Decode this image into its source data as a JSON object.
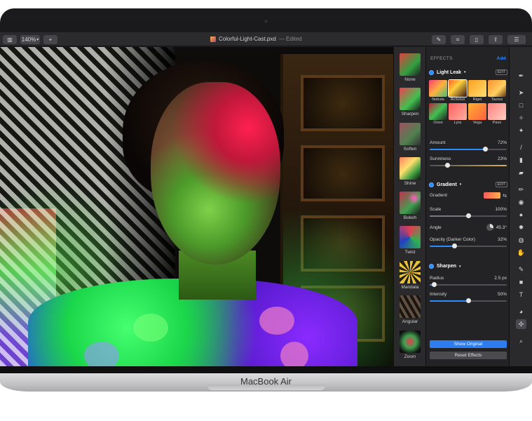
{
  "device": {
    "label": "MacBook Air"
  },
  "toolbar": {
    "zoom": "140%",
    "add": "+",
    "file_name": "Colorful-Light-Cast.pxd",
    "status": "— Edited"
  },
  "presets": [
    {
      "label": "None"
    },
    {
      "label": "Sharpen"
    },
    {
      "label": "Soften"
    },
    {
      "label": "Shine"
    },
    {
      "label": "Bokeh"
    },
    {
      "label": "Twist"
    },
    {
      "label": "Mandala"
    },
    {
      "label": "Angular"
    },
    {
      "label": "Zoom"
    }
  ],
  "effects": {
    "header": "EFFECTS",
    "add": "Add",
    "light_leak": {
      "title": "Light Leak",
      "edit": "EDIT",
      "swatches": [
        "Nebula",
        "Arcturus",
        "Rigel",
        "Taurus",
        "Orion",
        "Lyra",
        "Vega",
        "Pavo"
      ],
      "amount_label": "Amount",
      "amount_value": "72%",
      "amount": 0.72,
      "sunniness_label": "Sunniness",
      "sunniness_value": "23%",
      "sunniness": 0.23
    },
    "gradient": {
      "title": "Gradient",
      "edit": "EDIT",
      "gradient_label": "Gradient",
      "scale_label": "Scale",
      "scale_value": "100%",
      "scale": 0.5,
      "angle_label": "Angle",
      "angle_value": "45.3°",
      "opacity_label": "Opacity (Darker Color)",
      "opacity_value": "32%",
      "opacity": 0.32
    },
    "sharpen": {
      "title": "Sharpen",
      "radius_label": "Radius",
      "radius_value": "2.5 px",
      "radius": 0.05,
      "intensity_label": "Intensity",
      "intensity_value": "50%",
      "intensity": 0.5
    },
    "show_original": "Show Original",
    "reset_effects": "Reset Effects"
  },
  "colors": {
    "accent": "#2d8cff",
    "panel": "#232326",
    "toolbar": "#2b2b2e"
  }
}
